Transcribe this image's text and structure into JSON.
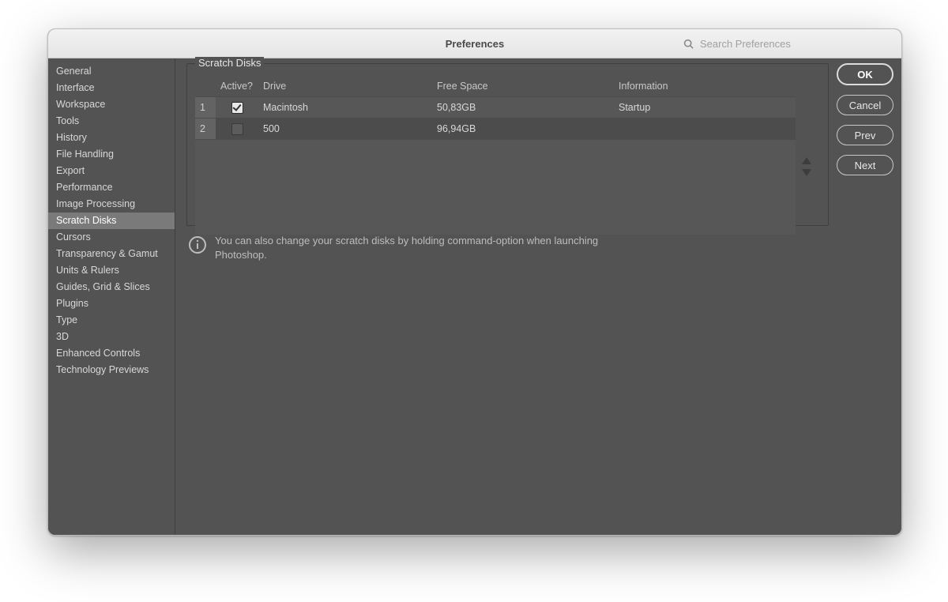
{
  "window": {
    "title": "Preferences",
    "search_placeholder": "Search Preferences"
  },
  "sidebar": {
    "selected_index": 9,
    "items": [
      "General",
      "Interface",
      "Workspace",
      "Tools",
      "History",
      "File Handling",
      "Export",
      "Performance",
      "Image Processing",
      "Scratch Disks",
      "Cursors",
      "Transparency & Gamut",
      "Units & Rulers",
      "Guides, Grid & Slices",
      "Plugins",
      "Type",
      "3D",
      "Enhanced Controls",
      "Technology Previews"
    ]
  },
  "panel": {
    "title": "Scratch Disks",
    "columns": {
      "active": "Active?",
      "drive": "Drive",
      "free": "Free Space",
      "info": "Information"
    },
    "rows": [
      {
        "index": "1",
        "active": true,
        "drive": "Macintosh",
        "free": "50,83GB",
        "info": "Startup"
      },
      {
        "index": "2",
        "active": false,
        "drive": "500",
        "free": "96,94GB",
        "info": ""
      }
    ],
    "hint": "You can also change your scratch disks by holding command-option when launching Photoshop."
  },
  "buttons": {
    "ok": "OK",
    "cancel": "Cancel",
    "prev": "Prev",
    "next": "Next"
  }
}
